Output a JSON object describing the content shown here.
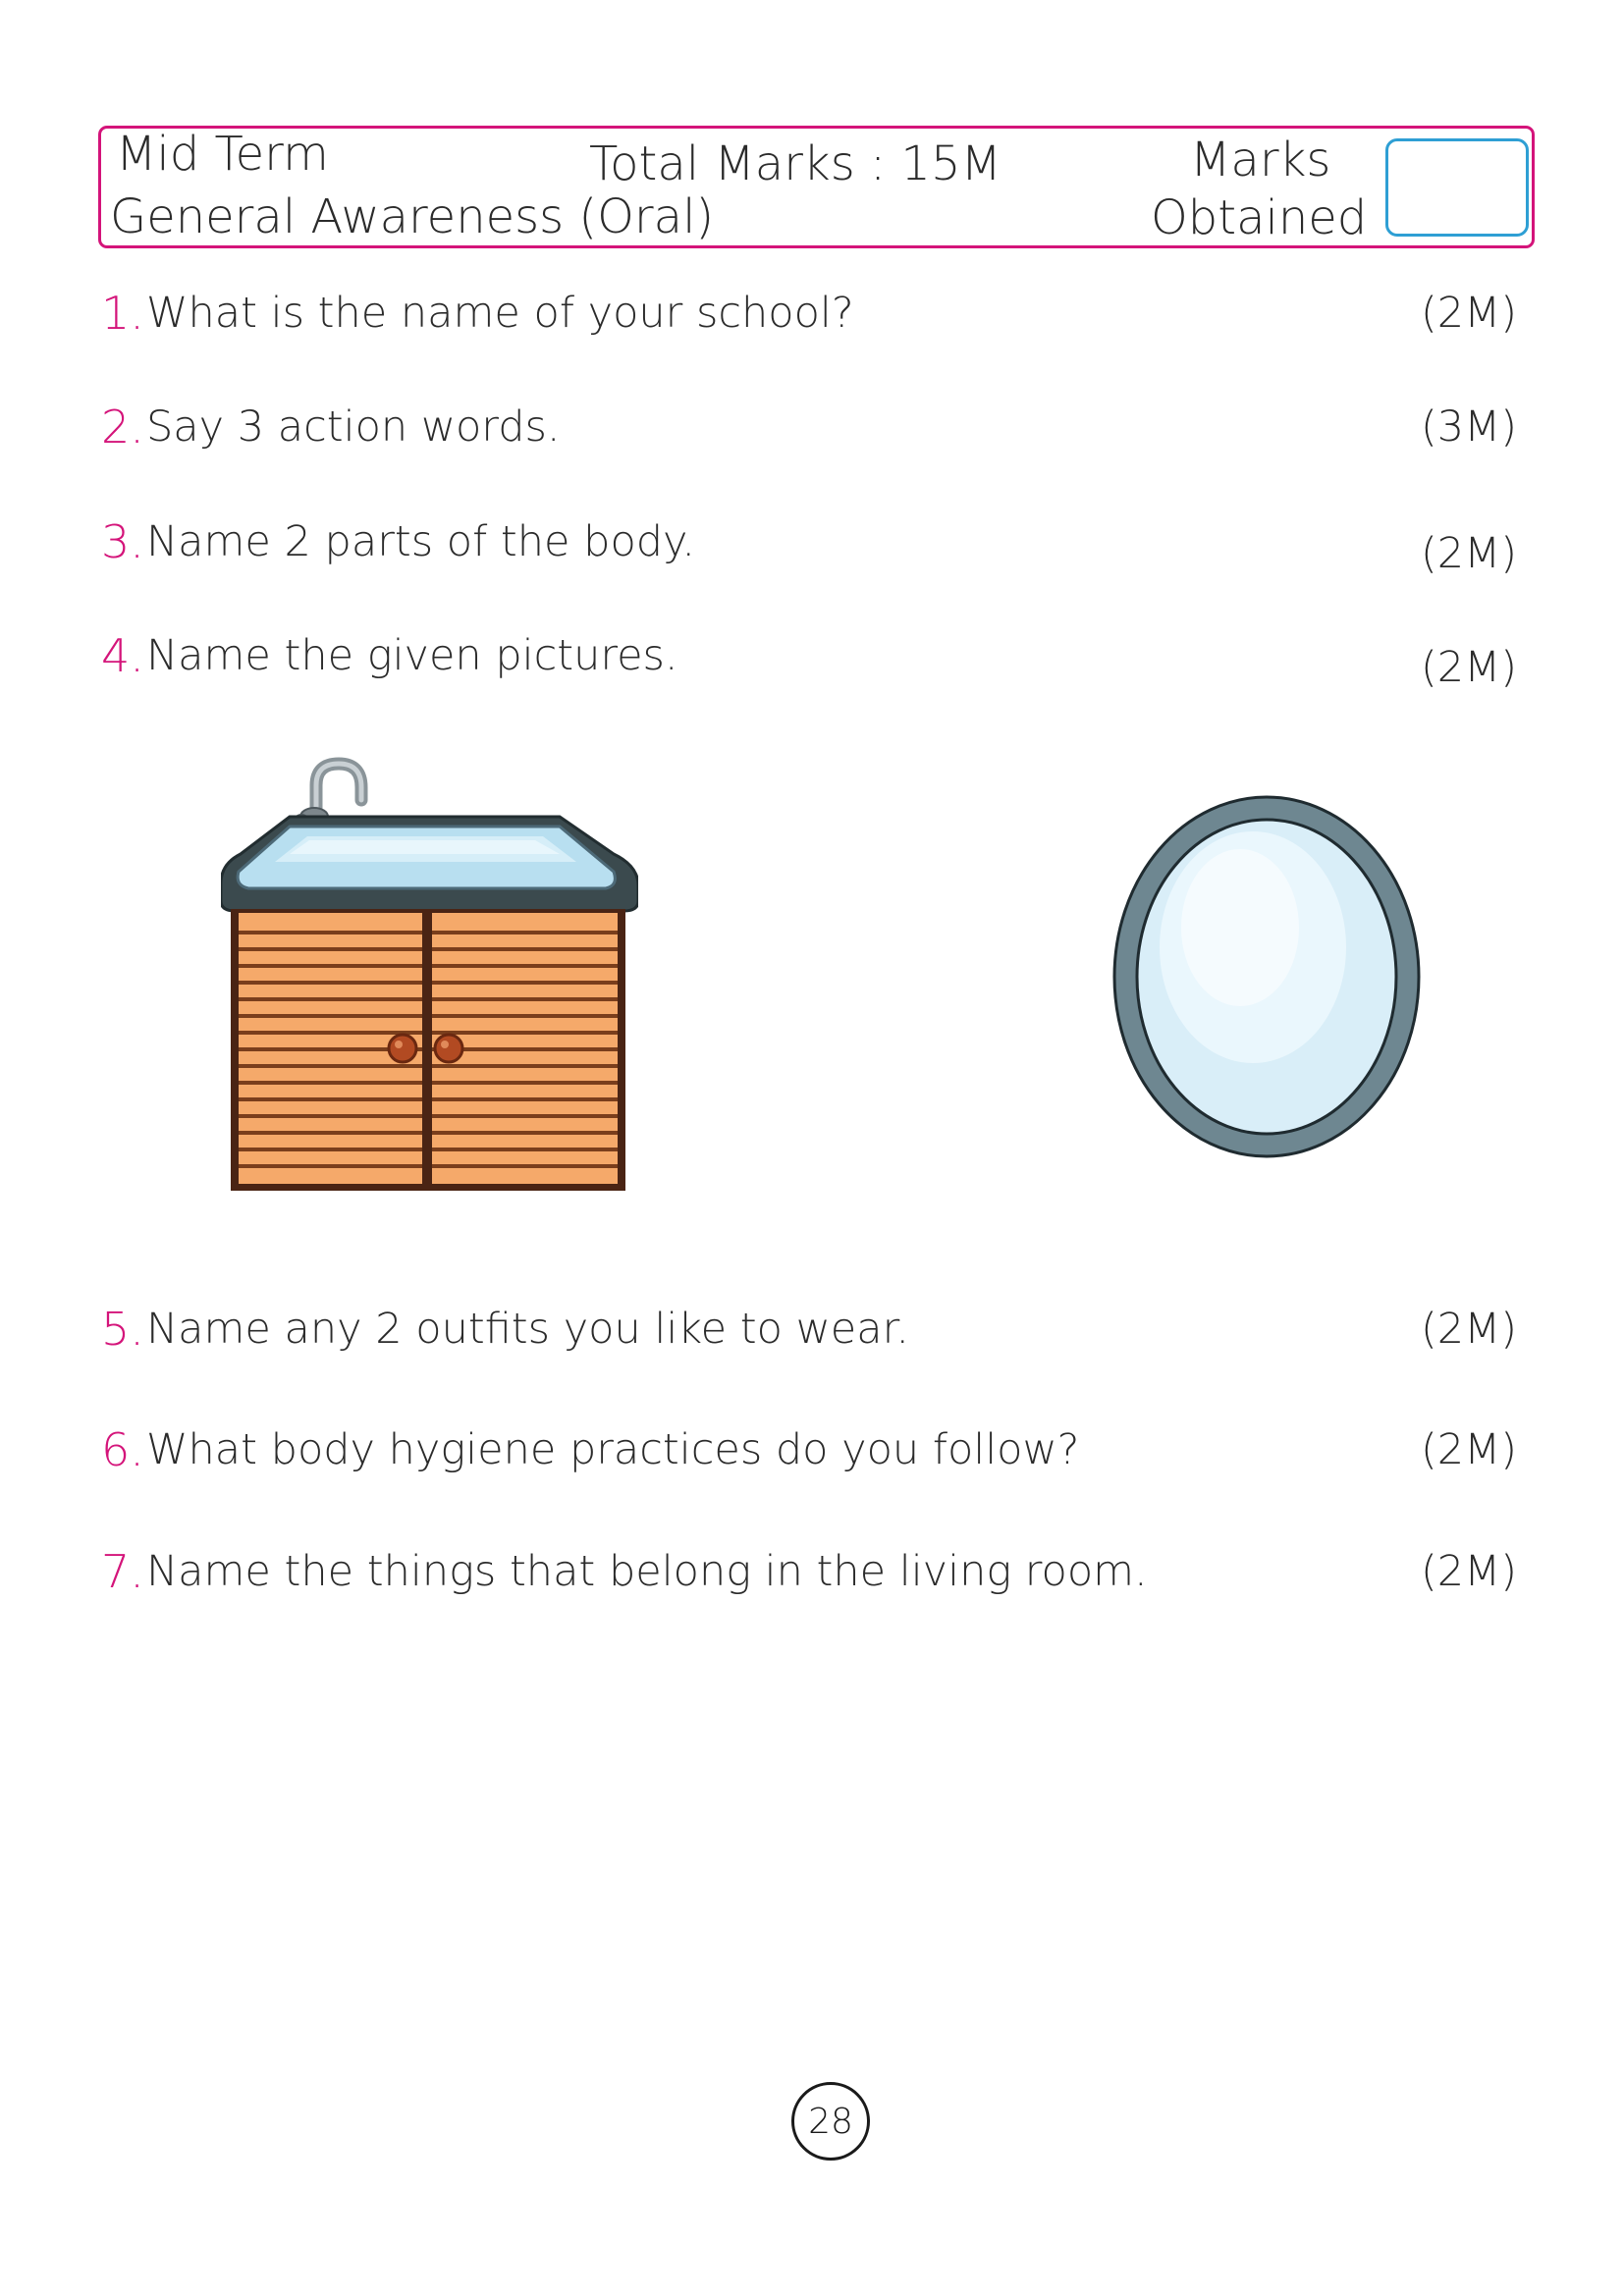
{
  "header": {
    "exam": "Mid Term",
    "subject": "General Awareness (Oral)",
    "total_marks": "Total Marks : 15M",
    "marks_label_1": "Marks",
    "marks_label_2": "Obtained",
    "marks_value": ""
  },
  "questions": [
    {
      "num": "1.",
      "text": "What is the name of your school?",
      "marks": "(2M)"
    },
    {
      "num": "2.",
      "text": "Say 3 action words.",
      "marks": "(3M)"
    },
    {
      "num": "3.",
      "text": "Name 2 parts of the body.",
      "marks": "(2M)"
    },
    {
      "num": "4.",
      "text": "Name the given pictures.",
      "marks": "(2M)"
    },
    {
      "num": "5.",
      "text": "Name any 2 outfits you like to wear.",
      "marks": "(2M)"
    },
    {
      "num": "6.",
      "text": "What body hygiene practices do you follow?",
      "marks": "(2M)"
    },
    {
      "num": "7.",
      "text": "Name the things that belong in the living room.",
      "marks": "(2M)"
    }
  ],
  "pictures": [
    {
      "icon": "wash-basin-cabinet-icon"
    },
    {
      "icon": "oval-mirror-icon"
    }
  ],
  "colors": {
    "accent": "#d4147a",
    "input_border": "#2e9fd4"
  },
  "page_number": "28"
}
